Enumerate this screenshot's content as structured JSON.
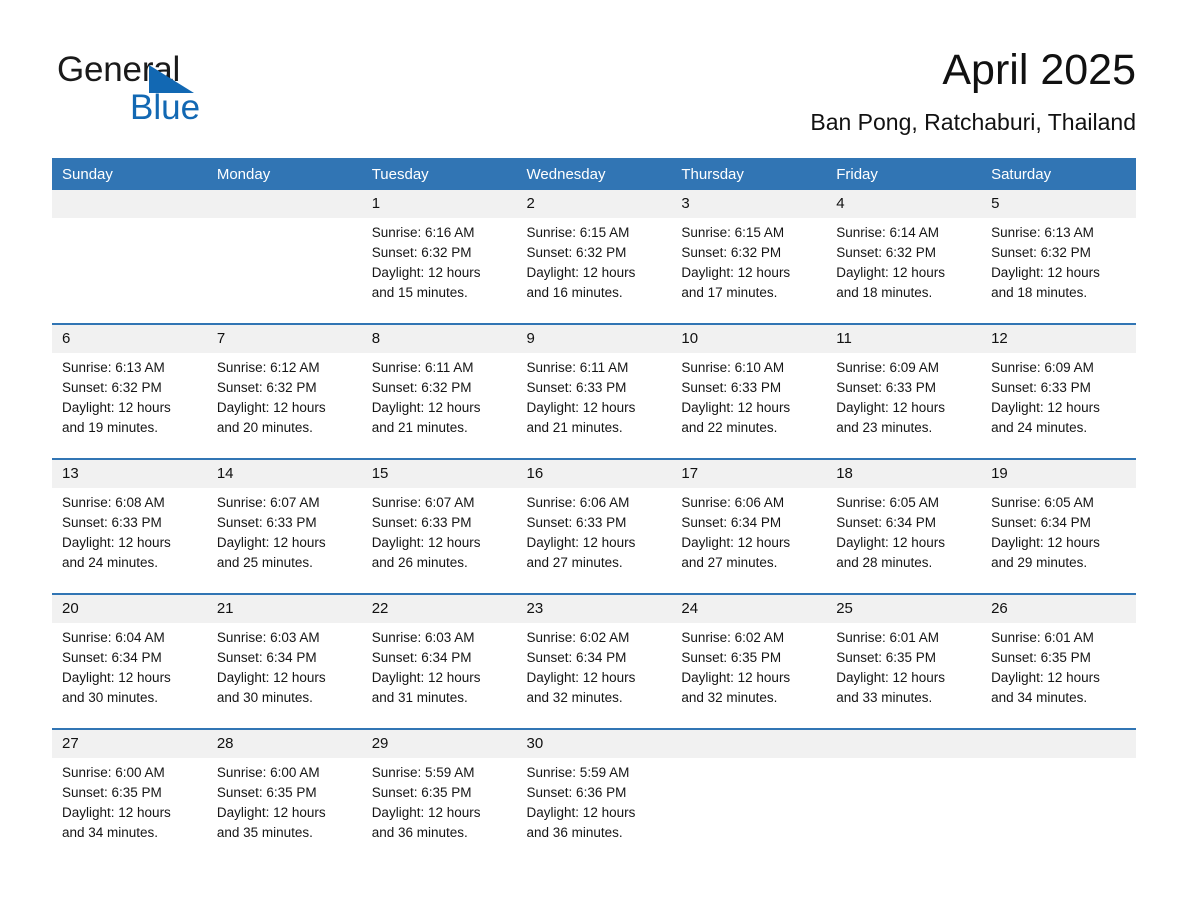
{
  "brand": {
    "name_part1": "General",
    "name_part2": "Blue",
    "triangle_color": "#1268b3",
    "text_color": "#1a1a1a"
  },
  "header": {
    "month_title": "April 2025",
    "location": "Ban Pong, Ratchaburi, Thailand"
  },
  "theme": {
    "header_blue": "#3175b4",
    "rule_blue": "#3175b4",
    "daynum_band": "#f1f1f1",
    "cell_bg": "#ffffff",
    "text": "#111111"
  },
  "calendar": {
    "weekday_headers": [
      "Sunday",
      "Monday",
      "Tuesday",
      "Wednesday",
      "Thursday",
      "Friday",
      "Saturday"
    ],
    "weeks": [
      {
        "days": [
          {
            "num": "",
            "sunrise": "",
            "sunset": "",
            "daylight1": "",
            "daylight2": ""
          },
          {
            "num": "",
            "sunrise": "",
            "sunset": "",
            "daylight1": "",
            "daylight2": ""
          },
          {
            "num": "1",
            "sunrise": "Sunrise: 6:16 AM",
            "sunset": "Sunset: 6:32 PM",
            "daylight1": "Daylight: 12 hours",
            "daylight2": "and 15 minutes."
          },
          {
            "num": "2",
            "sunrise": "Sunrise: 6:15 AM",
            "sunset": "Sunset: 6:32 PM",
            "daylight1": "Daylight: 12 hours",
            "daylight2": "and 16 minutes."
          },
          {
            "num": "3",
            "sunrise": "Sunrise: 6:15 AM",
            "sunset": "Sunset: 6:32 PM",
            "daylight1": "Daylight: 12 hours",
            "daylight2": "and 17 minutes."
          },
          {
            "num": "4",
            "sunrise": "Sunrise: 6:14 AM",
            "sunset": "Sunset: 6:32 PM",
            "daylight1": "Daylight: 12 hours",
            "daylight2": "and 18 minutes."
          },
          {
            "num": "5",
            "sunrise": "Sunrise: 6:13 AM",
            "sunset": "Sunset: 6:32 PM",
            "daylight1": "Daylight: 12 hours",
            "daylight2": "and 18 minutes."
          }
        ]
      },
      {
        "days": [
          {
            "num": "6",
            "sunrise": "Sunrise: 6:13 AM",
            "sunset": "Sunset: 6:32 PM",
            "daylight1": "Daylight: 12 hours",
            "daylight2": "and 19 minutes."
          },
          {
            "num": "7",
            "sunrise": "Sunrise: 6:12 AM",
            "sunset": "Sunset: 6:32 PM",
            "daylight1": "Daylight: 12 hours",
            "daylight2": "and 20 minutes."
          },
          {
            "num": "8",
            "sunrise": "Sunrise: 6:11 AM",
            "sunset": "Sunset: 6:32 PM",
            "daylight1": "Daylight: 12 hours",
            "daylight2": "and 21 minutes."
          },
          {
            "num": "9",
            "sunrise": "Sunrise: 6:11 AM",
            "sunset": "Sunset: 6:33 PM",
            "daylight1": "Daylight: 12 hours",
            "daylight2": "and 21 minutes."
          },
          {
            "num": "10",
            "sunrise": "Sunrise: 6:10 AM",
            "sunset": "Sunset: 6:33 PM",
            "daylight1": "Daylight: 12 hours",
            "daylight2": "and 22 minutes."
          },
          {
            "num": "11",
            "sunrise": "Sunrise: 6:09 AM",
            "sunset": "Sunset: 6:33 PM",
            "daylight1": "Daylight: 12 hours",
            "daylight2": "and 23 minutes."
          },
          {
            "num": "12",
            "sunrise": "Sunrise: 6:09 AM",
            "sunset": "Sunset: 6:33 PM",
            "daylight1": "Daylight: 12 hours",
            "daylight2": "and 24 minutes."
          }
        ]
      },
      {
        "days": [
          {
            "num": "13",
            "sunrise": "Sunrise: 6:08 AM",
            "sunset": "Sunset: 6:33 PM",
            "daylight1": "Daylight: 12 hours",
            "daylight2": "and 24 minutes."
          },
          {
            "num": "14",
            "sunrise": "Sunrise: 6:07 AM",
            "sunset": "Sunset: 6:33 PM",
            "daylight1": "Daylight: 12 hours",
            "daylight2": "and 25 minutes."
          },
          {
            "num": "15",
            "sunrise": "Sunrise: 6:07 AM",
            "sunset": "Sunset: 6:33 PM",
            "daylight1": "Daylight: 12 hours",
            "daylight2": "and 26 minutes."
          },
          {
            "num": "16",
            "sunrise": "Sunrise: 6:06 AM",
            "sunset": "Sunset: 6:33 PM",
            "daylight1": "Daylight: 12 hours",
            "daylight2": "and 27 minutes."
          },
          {
            "num": "17",
            "sunrise": "Sunrise: 6:06 AM",
            "sunset": "Sunset: 6:34 PM",
            "daylight1": "Daylight: 12 hours",
            "daylight2": "and 27 minutes."
          },
          {
            "num": "18",
            "sunrise": "Sunrise: 6:05 AM",
            "sunset": "Sunset: 6:34 PM",
            "daylight1": "Daylight: 12 hours",
            "daylight2": "and 28 minutes."
          },
          {
            "num": "19",
            "sunrise": "Sunrise: 6:05 AM",
            "sunset": "Sunset: 6:34 PM",
            "daylight1": "Daylight: 12 hours",
            "daylight2": "and 29 minutes."
          }
        ]
      },
      {
        "days": [
          {
            "num": "20",
            "sunrise": "Sunrise: 6:04 AM",
            "sunset": "Sunset: 6:34 PM",
            "daylight1": "Daylight: 12 hours",
            "daylight2": "and 30 minutes."
          },
          {
            "num": "21",
            "sunrise": "Sunrise: 6:03 AM",
            "sunset": "Sunset: 6:34 PM",
            "daylight1": "Daylight: 12 hours",
            "daylight2": "and 30 minutes."
          },
          {
            "num": "22",
            "sunrise": "Sunrise: 6:03 AM",
            "sunset": "Sunset: 6:34 PM",
            "daylight1": "Daylight: 12 hours",
            "daylight2": "and 31 minutes."
          },
          {
            "num": "23",
            "sunrise": "Sunrise: 6:02 AM",
            "sunset": "Sunset: 6:34 PM",
            "daylight1": "Daylight: 12 hours",
            "daylight2": "and 32 minutes."
          },
          {
            "num": "24",
            "sunrise": "Sunrise: 6:02 AM",
            "sunset": "Sunset: 6:35 PM",
            "daylight1": "Daylight: 12 hours",
            "daylight2": "and 32 minutes."
          },
          {
            "num": "25",
            "sunrise": "Sunrise: 6:01 AM",
            "sunset": "Sunset: 6:35 PM",
            "daylight1": "Daylight: 12 hours",
            "daylight2": "and 33 minutes."
          },
          {
            "num": "26",
            "sunrise": "Sunrise: 6:01 AM",
            "sunset": "Sunset: 6:35 PM",
            "daylight1": "Daylight: 12 hours",
            "daylight2": "and 34 minutes."
          }
        ]
      },
      {
        "days": [
          {
            "num": "27",
            "sunrise": "Sunrise: 6:00 AM",
            "sunset": "Sunset: 6:35 PM",
            "daylight1": "Daylight: 12 hours",
            "daylight2": "and 34 minutes."
          },
          {
            "num": "28",
            "sunrise": "Sunrise: 6:00 AM",
            "sunset": "Sunset: 6:35 PM",
            "daylight1": "Daylight: 12 hours",
            "daylight2": "and 35 minutes."
          },
          {
            "num": "29",
            "sunrise": "Sunrise: 5:59 AM",
            "sunset": "Sunset: 6:35 PM",
            "daylight1": "Daylight: 12 hours",
            "daylight2": "and 36 minutes."
          },
          {
            "num": "30",
            "sunrise": "Sunrise: 5:59 AM",
            "sunset": "Sunset: 6:36 PM",
            "daylight1": "Daylight: 12 hours",
            "daylight2": "and 36 minutes."
          },
          {
            "num": "",
            "sunrise": "",
            "sunset": "",
            "daylight1": "",
            "daylight2": ""
          },
          {
            "num": "",
            "sunrise": "",
            "sunset": "",
            "daylight1": "",
            "daylight2": ""
          },
          {
            "num": "",
            "sunrise": "",
            "sunset": "",
            "daylight1": "",
            "daylight2": ""
          }
        ]
      }
    ]
  }
}
